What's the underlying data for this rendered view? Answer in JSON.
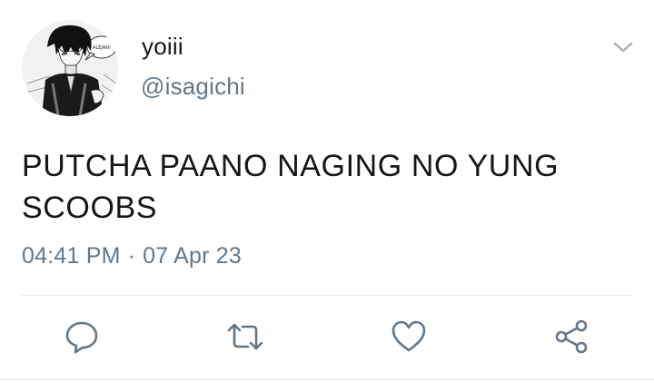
{
  "author": {
    "display_name": "yoiii",
    "handle": "@isagichi",
    "avatar_caption": "ALEJAN!"
  },
  "tweet": {
    "text": "PUTCHA PAANO NAGING NO YUNG SCOOBS",
    "time": "04:41 PM",
    "separator": "·",
    "date": "07 Apr 23"
  },
  "icons": {
    "menu": "chevron-down-icon",
    "reply": "reply-icon",
    "retweet": "retweet-icon",
    "like": "heart-icon",
    "share": "share-icon"
  },
  "colors": {
    "text": "#14171a",
    "secondary": "#657786",
    "divider": "#e1e8ed",
    "icon": "#657786"
  }
}
